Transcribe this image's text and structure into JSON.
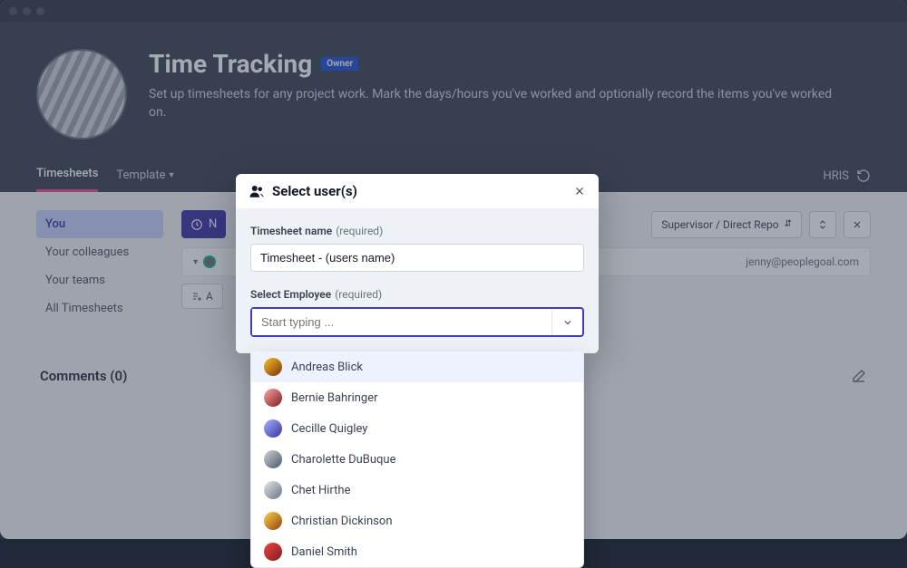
{
  "hero": {
    "title": "Time Tracking",
    "badge": "Owner",
    "desc": "Set up timesheets for any project work. Mark the days/hours you've worked and optionally record the items you've worked on."
  },
  "tabs": {
    "timesheets": "Timesheets",
    "template": "Template",
    "hris": "HRIS"
  },
  "side": {
    "you": "You",
    "colleagues": "Your colleagues",
    "teams": "Your teams",
    "all": "All Timesheets"
  },
  "toolbar": {
    "new_label": "N",
    "filter": "Supervisor / Direct Repo",
    "row_email": "jenny@peoplegoal.com",
    "add": "A"
  },
  "comments": {
    "heading": "Comments (0)"
  },
  "modal": {
    "title": "Select user(s)",
    "name_label": "Timesheet name",
    "required": "(required)",
    "name_value": "Timesheet - (users name)",
    "employee_label": "Select Employee",
    "placeholder": "Start typing ...",
    "options": [
      "Andreas Blick",
      "Bernie Bahringer",
      "Cecille Quigley",
      "Charolette DuBuque",
      "Chet Hirthe",
      "Christian Dickinson",
      "Daniel Smith"
    ]
  }
}
